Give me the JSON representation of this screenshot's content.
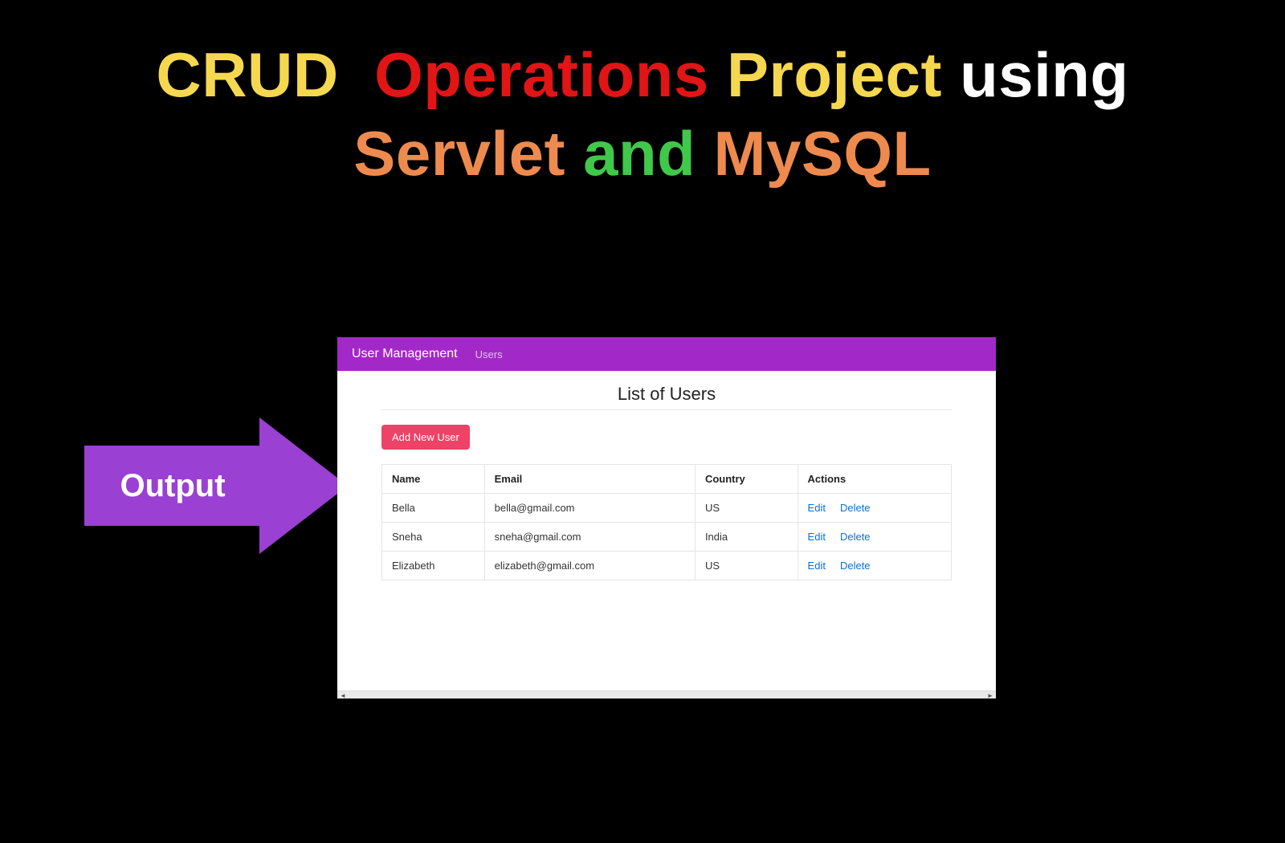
{
  "heading": {
    "crud": "CRUD",
    "operations": "Operations",
    "project": "Project",
    "using": "using",
    "servlet": "Servlet",
    "and": "and",
    "mysql": "MySQL"
  },
  "arrow_label": "Output",
  "app": {
    "nav": {
      "brand": "User Management",
      "link_users": "Users"
    },
    "page_title": "List of Users",
    "add_button_label": "Add New User",
    "table": {
      "headers": {
        "name": "Name",
        "email": "Email",
        "country": "Country",
        "actions": "Actions"
      },
      "action_labels": {
        "edit": "Edit",
        "delete": "Delete"
      },
      "rows": [
        {
          "name": "Bella",
          "email": "bella@gmail.com",
          "country": "US"
        },
        {
          "name": "Sneha",
          "email": "sneha@gmail.com",
          "country": "India"
        },
        {
          "name": "Elizabeth",
          "email": "elizabeth@gmail.com",
          "country": "US"
        }
      ]
    }
  }
}
